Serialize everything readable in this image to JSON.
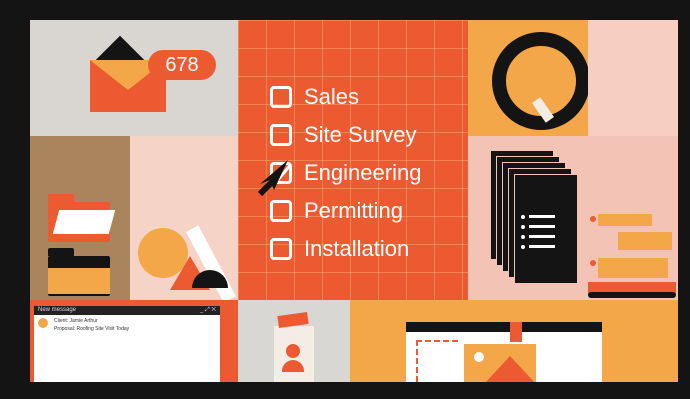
{
  "mail": {
    "unread_count": "678",
    "icon": "envelope-icon"
  },
  "checklist": {
    "items": [
      {
        "label": "Sales",
        "checked": false
      },
      {
        "label": "Site Survey",
        "checked": false
      },
      {
        "label": "Engineering",
        "checked": true
      },
      {
        "label": "Permitting",
        "checked": false
      },
      {
        "label": "Installation",
        "checked": false
      }
    ]
  },
  "compose_window": {
    "title": "New message",
    "controls": "_ ⤢ ✕",
    "to": "Client: Jamie Arthur",
    "subject": "Proposal: Roofing Site Visit Today"
  },
  "colors": {
    "accent": "#ec5a32",
    "accent_yellow": "#f4a748",
    "pink": "#f6cfc2",
    "dark": "#141414"
  }
}
